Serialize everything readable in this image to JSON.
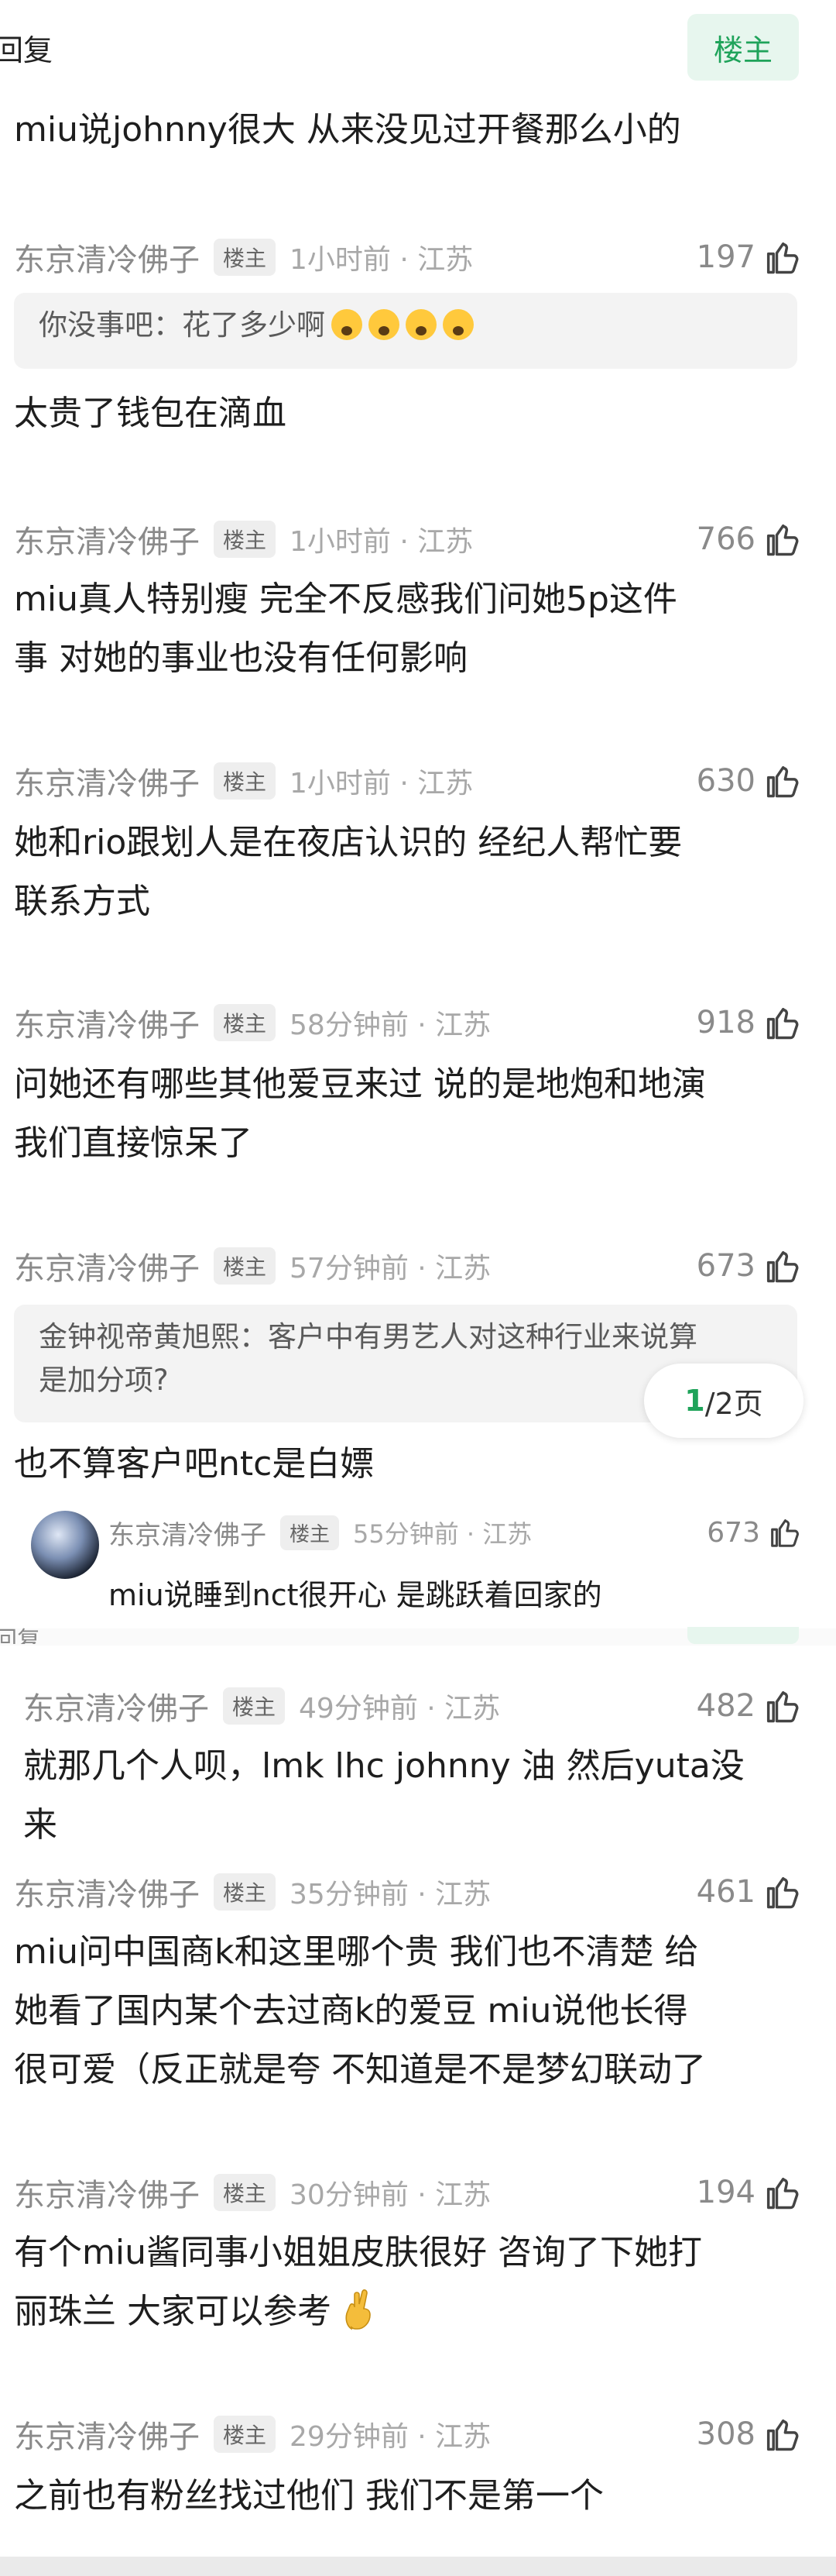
{
  "top": {
    "reply_label": "回复",
    "owner_button": "楼主"
  },
  "op_badge": "楼主",
  "author_name": "东京清冷佛子",
  "comments": [
    {
      "text": "miu说johnny很大 从来没见过开餐那么小的"
    },
    {
      "time": "1小时前 · 江苏",
      "likes": "197",
      "quote": "你没事吧：花了多少啊",
      "quote_emoji": [
        "scream-emoji",
        "scream-emoji",
        "scream-emoji",
        "scream-emoji"
      ],
      "text": "太贵了钱包在滴血"
    },
    {
      "time": "1小时前 · 江苏",
      "likes": "766",
      "text_lines": [
        "miu真人特别瘦 完全不反感我们问她5p这件",
        "事 对她的事业也没有任何影响"
      ]
    },
    {
      "time": "1小时前 · 江苏",
      "likes": "630",
      "text_lines": [
        "她和rio跟划人是在夜店认识的 经纪人帮忙要",
        "联系方式"
      ]
    },
    {
      "time": "58分钟前 · 江苏",
      "likes": "918",
      "text_lines": [
        "问她还有哪些其他爱豆来过 说的是地炮和地演",
        "我们直接惊呆了"
      ]
    },
    {
      "time": "57分钟前 · 江苏",
      "likes": "673",
      "quote_lines": [
        "金钟视帝黄旭熙：客户中有男艺人对这种行业来说算",
        "是加分项?"
      ],
      "text": "也不算客户吧ntc是白嫖"
    },
    {
      "time": "49分钟前 · 江苏",
      "likes": "482",
      "text_lines": [
        "就那几个人呗，lmk lhc johnny 油 然后yuta没",
        "来"
      ]
    },
    {
      "time": "35分钟前 · 江苏",
      "likes": "461",
      "text_lines": [
        "miu问中国商k和这里哪个贵 我们也不清楚 给",
        "她看了国内某个去过商k的爱豆 miu说他长得",
        "很可爱（反正就是夸 不知道是不是梦幻联动了"
      ]
    },
    {
      "time": "30分钟前 · 江苏",
      "likes": "194",
      "text_lines": [
        "有个miu酱同事小姐姐皮肤很好 咨询了下她打",
        "丽珠兰 大家可以参考"
      ],
      "emoji": "crossed-fingers-emoji"
    },
    {
      "time": "29分钟前 · 江苏",
      "likes": "308",
      "text_lines": [
        "之前也有粉丝找过他们 我们不是第一个"
      ]
    }
  ],
  "floating_reply": {
    "time": "55分钟前 · 江苏",
    "likes": "673",
    "text": "miu说睡到nct很开心 是跳跃着回家的"
  },
  "pagination": {
    "current": "1",
    "rest": "/2页"
  }
}
